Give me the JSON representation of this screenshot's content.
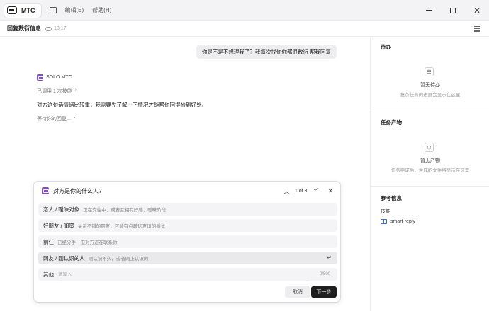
{
  "titlebar": {
    "app_name": "MTC",
    "menu": [
      "编辑(E)",
      "帮助(H)"
    ]
  },
  "header": {
    "title": "回复数衍信息",
    "time": "13:17"
  },
  "conversation": {
    "user_message": "你是不是不想理我了？我每次找你你都很敷衍 帮我回复",
    "bot_name": "SOLO MTC",
    "skill_used": "已调用 1 次技能",
    "bot_text": "对方这句话情绪比较重，我需要先了解一下情况才能帮你回得恰到好处。",
    "waiting": "等待你的回复..."
  },
  "question_card": {
    "title": "对方是你的什么人?",
    "pager": "1 of 3",
    "options": [
      {
        "label": "恋人 / 暧昧对象",
        "desc": "正在交往中，或者互相有好感、暧昧阶段"
      },
      {
        "label": "好朋友 / 闺蜜",
        "desc": "关系不错的朋友，可能有点疏远友谊的感觉"
      },
      {
        "label": "前任",
        "desc": "已经分手，但对方还在联系你"
      },
      {
        "label": "网友 / 刚认识的人",
        "desc": "刚认识不久，或者网上认识的"
      }
    ],
    "other_label": "其他",
    "other_placeholder": "请输入",
    "char_count": "0/500",
    "cancel_label": "取消",
    "next_label": "下一步"
  },
  "sidebar": {
    "todo_title": "待办",
    "todo_empty_title": "暂无待办",
    "todo_empty_desc": "复杂任务的进展会显示在这里",
    "output_title": "任务产物",
    "output_empty_title": "暂无产物",
    "output_empty_desc": "任务完成后，生成的文件将显示在这里",
    "ref_title": "参考信息",
    "ref_label": "技能",
    "ref_skill": "smart-reply"
  }
}
